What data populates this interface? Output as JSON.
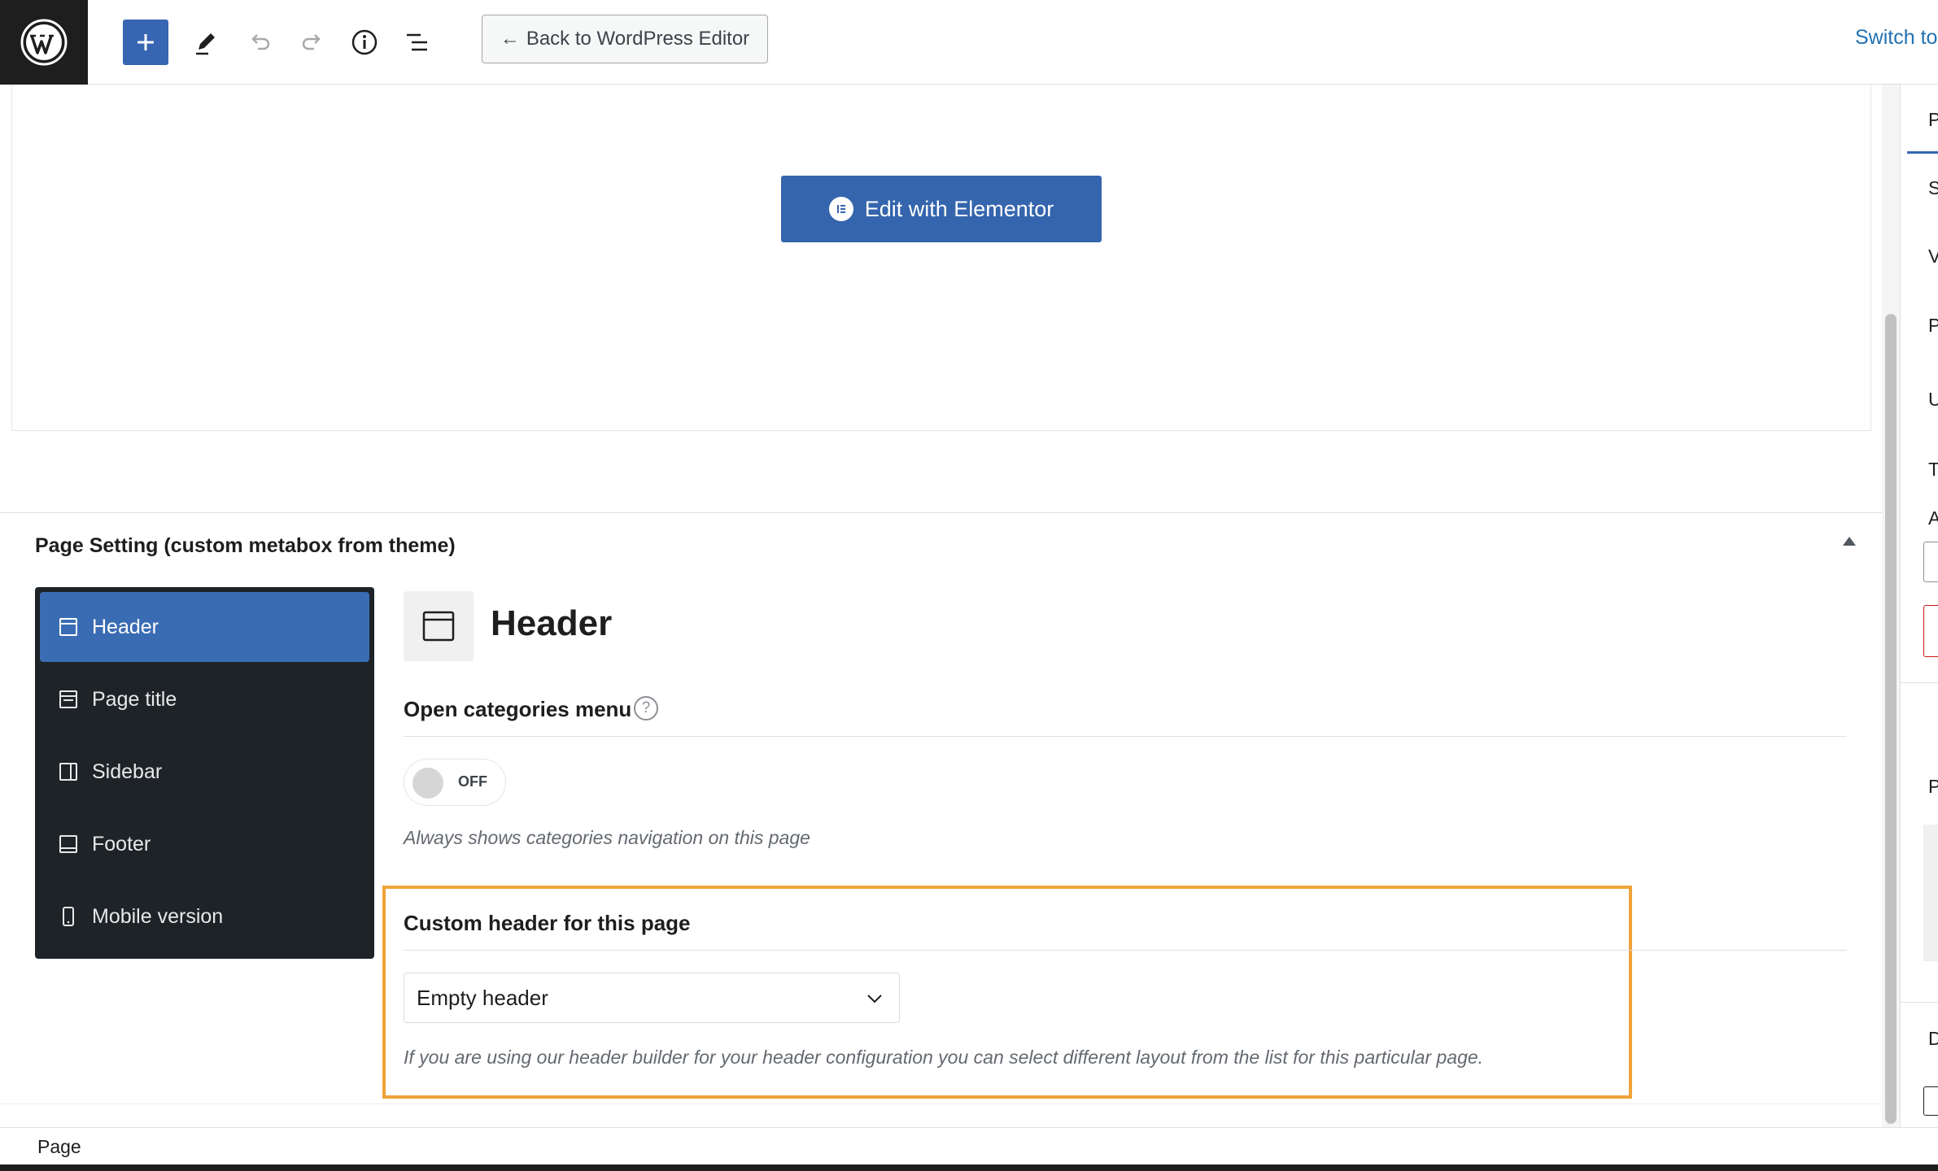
{
  "toolbar": {
    "back_label": "Back to WordPress Editor",
    "switch_label": "Switch to"
  },
  "editor": {
    "elementor_button": "Edit with Elementor"
  },
  "metabox": {
    "title": "Page Setting (custom metabox from theme)",
    "nav": [
      {
        "label": "Header",
        "icon": "header-icon",
        "active": true
      },
      {
        "label": "Page title",
        "icon": "page-title-icon",
        "active": false
      },
      {
        "label": "Sidebar",
        "icon": "sidebar-icon",
        "active": false
      },
      {
        "label": "Footer",
        "icon": "footer-icon",
        "active": false
      },
      {
        "label": "Mobile version",
        "icon": "mobile-icon",
        "active": false
      }
    ],
    "section_title": "Header",
    "open_categories": {
      "label": "Open categories menu",
      "help": "?",
      "toggle_state": "OFF",
      "description": "Always shows categories navigation on this page"
    },
    "custom_header": {
      "label": "Custom header for this page",
      "selected": "Empty header",
      "description": "If you are using our header builder for your header configuration you can select different layout from the list for this particular page."
    }
  },
  "right_panel": {
    "letters": [
      "P",
      "S",
      "V",
      "P",
      "U",
      "T",
      "A",
      "P",
      "D"
    ]
  },
  "status": {
    "breadcrumb": "Page"
  },
  "colors": {
    "accent": "#3765b1",
    "highlight": "#f0a33a",
    "nav_bg": "#1e2328"
  }
}
